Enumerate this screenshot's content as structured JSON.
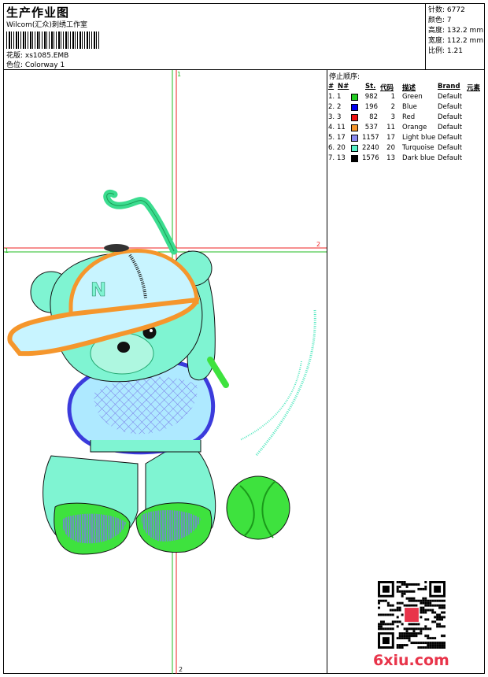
{
  "header": {
    "title": "生产作业图",
    "studio": "Wilcom(汇众)刺绣工作室",
    "file_label": "花版:",
    "file_value": "xs1085.EMB",
    "colorway_label": "色位:",
    "colorway_value": "Colorway 1"
  },
  "stats": {
    "stitches": {
      "label": "针数:",
      "value": "6772"
    },
    "colors": {
      "label": "颜色:",
      "value": "7"
    },
    "height": {
      "label": "高度:",
      "value": "132.2 mm"
    },
    "width": {
      "label": "宽度:",
      "value": "112.2 mm"
    },
    "scale": {
      "label": "比例:",
      "value": "1.21"
    }
  },
  "stop_sequence": {
    "title": "停止顺序:",
    "headers": {
      "seq": "#",
      "num": "N#",
      "stitches": "St.",
      "code": "代码",
      "desc": "描述",
      "brand": "Brand",
      "element": "元素"
    },
    "rows": [
      {
        "seq": "1.",
        "num": "1",
        "color": "#22cc22",
        "stitches": "982",
        "code": "1",
        "desc": "Green",
        "brand": "Default"
      },
      {
        "seq": "2.",
        "num": "2",
        "color": "#0000ee",
        "stitches": "196",
        "code": "2",
        "desc": "Blue",
        "brand": "Default"
      },
      {
        "seq": "3.",
        "num": "3",
        "color": "#ee1111",
        "stitches": "82",
        "code": "3",
        "desc": "Red",
        "brand": "Default"
      },
      {
        "seq": "4.",
        "num": "11",
        "color": "#f5962c",
        "stitches": "537",
        "code": "11",
        "desc": "Orange",
        "brand": "Default"
      },
      {
        "seq": "5.",
        "num": "17",
        "color": "#8a8af0",
        "stitches": "1157",
        "code": "17",
        "desc": "Light blue",
        "brand": "Default"
      },
      {
        "seq": "6.",
        "num": "20",
        "color": "#55f0c8",
        "stitches": "2240",
        "code": "20",
        "desc": "Turquoise",
        "brand": "Default"
      },
      {
        "seq": "7.",
        "num": "13",
        "color": "#000000",
        "stitches": "1576",
        "code": "13",
        "desc": "Dark blue",
        "brand": "Default"
      }
    ]
  },
  "guides": {
    "v1": "1",
    "h1": "1",
    "h2": "2",
    "v2": "2"
  },
  "watermark": "6xiu.com"
}
